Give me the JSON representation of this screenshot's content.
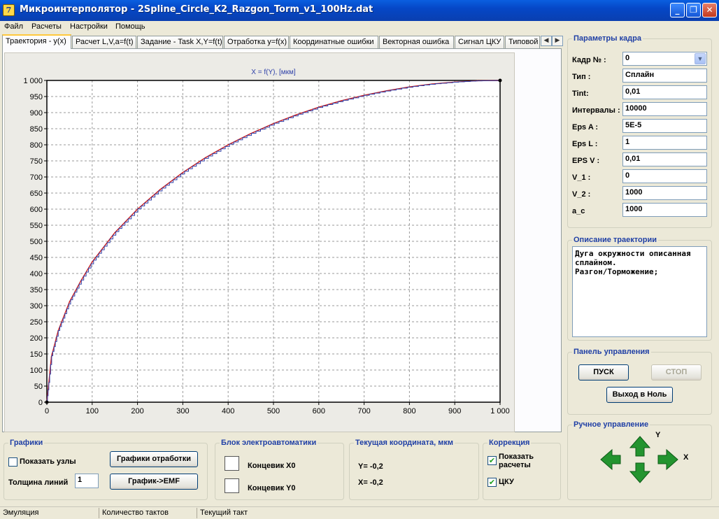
{
  "window": {
    "title": "Микроинтерполятор - 2Spline_Circle_K2_Razgon_Torm_v1_100Hz.dat",
    "icon": "app-logo-icon"
  },
  "menu": [
    "Файл",
    "Расчеты",
    "Настройки",
    "Помощь"
  ],
  "tabs": [
    "Траектория - y(x)",
    "Расчет L,V,a=f(t)",
    "Задание - Task X,Y=f(t)",
    "Отработка y=f(x)",
    "Координатные ошибки",
    "Векторная ошибка",
    "Сигнал ЦКУ",
    "Типовой"
  ],
  "chart_data": {
    "type": "line",
    "title": "X = f(Y), [мкм]",
    "xlim": [
      0,
      1000
    ],
    "ylim": [
      0,
      1000
    ],
    "x_ticks": [
      "0",
      "100",
      "200",
      "300",
      "400",
      "500",
      "600",
      "700",
      "800",
      "900",
      "1 000"
    ],
    "y_ticks": [
      "0",
      "50",
      "100",
      "150",
      "200",
      "250",
      "300",
      "350",
      "400",
      "450",
      "500",
      "550",
      "600",
      "650",
      "700",
      "750",
      "800",
      "850",
      "900",
      "950",
      "1 000"
    ],
    "grid": true,
    "series": [
      {
        "color": "#cc1f1f",
        "x": [
          0,
          10,
          25,
          50,
          75,
          100,
          150,
          200,
          250,
          300,
          350,
          400,
          450,
          500,
          550,
          600,
          650,
          700,
          750,
          800,
          850,
          900,
          950,
          1000
        ],
        "y": [
          0,
          141,
          222,
          312,
          377,
          436,
          527,
          600,
          661,
          714,
          760,
          800,
          835,
          866,
          893,
          917,
          937,
          954,
          968,
          980,
          989,
          995,
          999,
          1000
        ]
      },
      {
        "color": "#2d3fa8",
        "style": "staircase",
        "x": [
          0,
          10,
          25,
          50,
          75,
          100,
          150,
          200,
          250,
          300,
          350,
          400,
          450,
          500,
          550,
          600,
          650,
          700,
          750,
          800,
          850,
          900,
          950,
          1000
        ],
        "y": [
          0,
          141,
          222,
          312,
          377,
          436,
          527,
          600,
          661,
          714,
          760,
          800,
          835,
          866,
          893,
          917,
          937,
          954,
          968,
          980,
          989,
          995,
          999,
          1000
        ]
      }
    ]
  },
  "frame_params": {
    "title": "Параметры кадра",
    "rows": [
      {
        "label": "Кадр № :",
        "value": "0"
      },
      {
        "label": "Тип :",
        "value": "Сплайн"
      },
      {
        "label": "Tint:",
        "value": "0,01"
      },
      {
        "label": "Интервалы :",
        "value": "10000"
      },
      {
        "label": "Eps A :",
        "value": "5E-5"
      },
      {
        "label": "Eps L :",
        "value": "1"
      },
      {
        "label": "EPS V :",
        "value": "0,01"
      },
      {
        "label": "V_1 :",
        "value": "0"
      },
      {
        "label": "V_2 :",
        "value": "1000"
      },
      {
        "label": "a_c",
        "value": "1000"
      }
    ]
  },
  "trajectory": {
    "title": "Описание траектории",
    "text": "Дуга окружности описанная\nсплайном.\nРазгон/Торможение;"
  },
  "control": {
    "title": "Панель управления",
    "start": "ПУСК",
    "stop": "СТОП",
    "home": "Выход в Ноль"
  },
  "manual": {
    "title": "Ручное управление",
    "y_label": "Y",
    "x_label": "X",
    "arrow_color": "#23942f"
  },
  "graphs": {
    "title": "Графики",
    "show_nodes": "Показать узлы",
    "show_nodes_checked": false,
    "btn_plots": "Графики отработки",
    "line_width_label": "Толщина линий",
    "line_width": "1",
    "btn_emf": "График->EMF"
  },
  "automation": {
    "title": "Блок электроавтоматики",
    "switch_x": "Концевик X0",
    "switch_y": "Концевик Y0"
  },
  "coords": {
    "title": "Текущая координата, мкм",
    "y": "Y= -0,2",
    "x": "X= -0,2"
  },
  "correction": {
    "title": "Коррекция",
    "show_calc": "Показать\nрасчеты",
    "show_calc_checked": true,
    "cku": "ЦКУ",
    "cku_checked": true
  },
  "status": [
    "Эмуляция",
    "Количество тактов",
    "Текущий такт"
  ]
}
